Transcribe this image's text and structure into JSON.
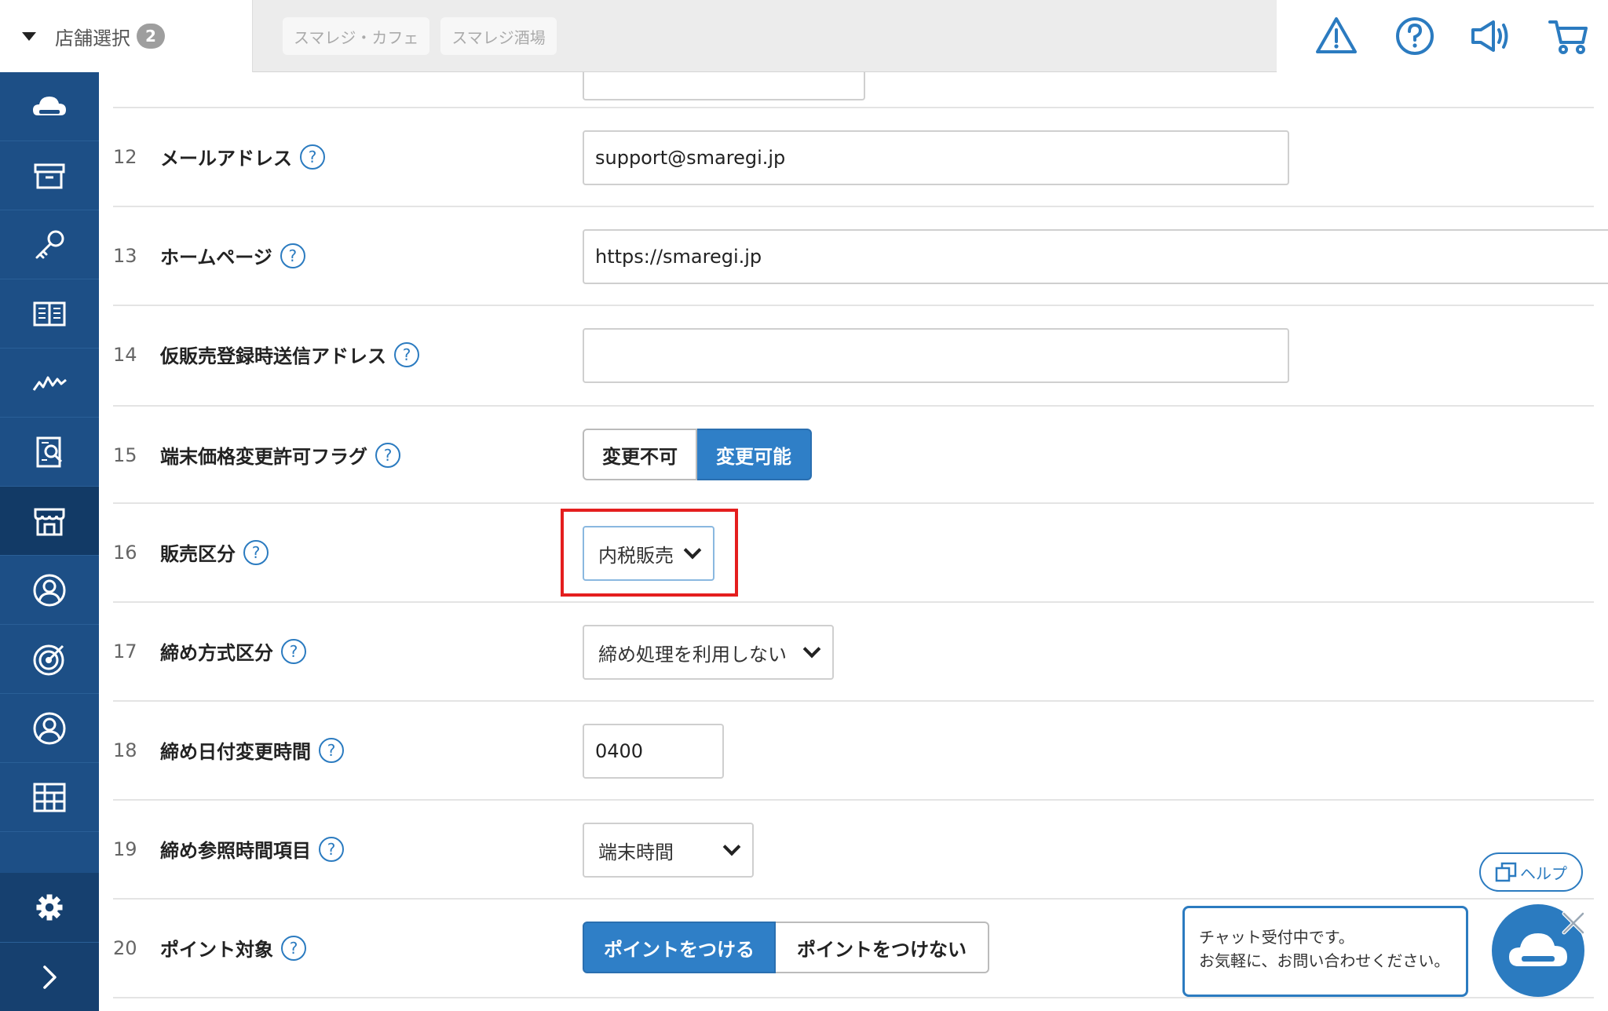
{
  "header": {
    "store_select_label": "店舗選択",
    "store_count": "2",
    "store_tags": [
      "スマレジ・カフェ",
      "スマレジ酒場"
    ],
    "icons": [
      "warning-icon",
      "help-icon",
      "announcement-icon",
      "cart-icon"
    ]
  },
  "sidebar": {
    "items": [
      "cloud-icon",
      "archive-icon",
      "key-icon",
      "book-icon",
      "chart-icon",
      "report-icon",
      "store-icon",
      "customer-icon",
      "target-icon",
      "user-icon",
      "grid-icon"
    ],
    "active": "store-icon",
    "bottom": [
      "gear-icon",
      "chevron-right-icon"
    ]
  },
  "form": {
    "rows": [
      {
        "num": "12",
        "label": "メールアドレス",
        "value": "support@smaregi.jp"
      },
      {
        "num": "13",
        "label": "ホームページ",
        "value": "https://smaregi.jp"
      },
      {
        "num": "14",
        "label": "仮販売登録時送信アドレス",
        "value": ""
      },
      {
        "num": "15",
        "label": "端末価格変更許可フラグ",
        "options": [
          "変更不可",
          "変更可能"
        ],
        "selected": "変更可能"
      },
      {
        "num": "16",
        "label": "販売区分",
        "value": "内税販売"
      },
      {
        "num": "17",
        "label": "締め方式区分",
        "value": "締め処理を利用しない"
      },
      {
        "num": "18",
        "label": "締め日付変更時間",
        "value": "0400"
      },
      {
        "num": "19",
        "label": "締め参照時間項目",
        "value": "端末時間"
      },
      {
        "num": "20",
        "label": "ポイント対象",
        "options": [
          "ポイントをつける",
          "ポイントをつけない"
        ],
        "selected": "ポイントをつける"
      }
    ]
  },
  "help_button": "ヘルプ",
  "chat": {
    "line1": "チャット受付中です。",
    "line2": "お気軽に、お問い合わせください。"
  },
  "colors": {
    "sidebar": "#1d4f86",
    "accent": "#2f7fc7",
    "highlight": "#e41e1e"
  }
}
